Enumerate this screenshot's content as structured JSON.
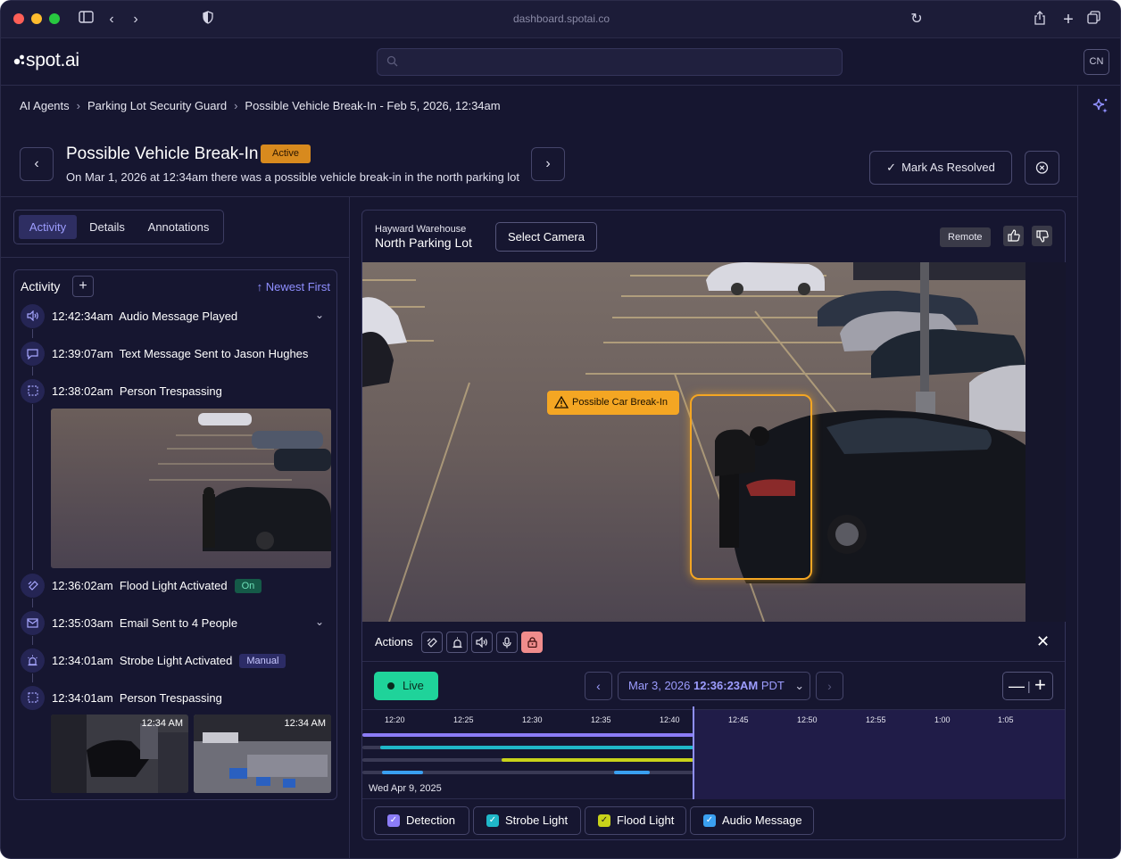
{
  "browser": {
    "url": "dashboard.spotai.co"
  },
  "app": {
    "logo": "spot.ai",
    "search_placeholder": "",
    "user_initials": "CN"
  },
  "breadcrumb": {
    "items": [
      "AI Agents",
      "Parking Lot Security Guard",
      "Possible Vehicle Break-In - Feb 5, 2026, 12:34am"
    ]
  },
  "incident": {
    "title": "Possible Vehicle Break-In",
    "status": "Active",
    "description": "On Mar 1, 2026 at 12:34am there was a possible vehicle break-in in the north parking lot",
    "resolve_label": "Mark As Resolved"
  },
  "tabs": [
    "Activity",
    "Details",
    "Annotations"
  ],
  "activity": {
    "title": "Activity",
    "sort_label": "Newest First",
    "items": [
      {
        "time": "12:42:34am",
        "text": "Audio Message Played",
        "icon": "speaker-icon"
      },
      {
        "time": "12:39:07am",
        "text": "Text Message Sent to Jason Hughes",
        "icon": "message-icon"
      },
      {
        "time": "12:38:02am",
        "text": "Person Trespassing",
        "icon": "person-detection-icon"
      },
      {
        "time": "12:36:02am",
        "text": "Flood Light Activated",
        "icon": "flood-light-icon",
        "badge": "On"
      },
      {
        "time": "12:35:03am",
        "text": "Email Sent to 4 People",
        "icon": "email-icon"
      },
      {
        "time": "12:34:01am",
        "text": "Strobe Light Activated",
        "icon": "strobe-light-icon",
        "badge": "Manual"
      },
      {
        "time": "12:34:01am",
        "text": "Person Trespassing",
        "icon": "person-detection-icon"
      }
    ],
    "thumb_times": [
      "12:34 AM",
      "12:34 AM"
    ]
  },
  "camera": {
    "site": "Hayward Warehouse",
    "name": "North Parking Lot",
    "select_label": "Select Camera",
    "mode": "Remote",
    "alert_label": "Possible Car Break-In"
  },
  "actions": {
    "label": "Actions",
    "buttons": [
      "flood-light-icon",
      "strobe-light-icon",
      "speaker-icon",
      "microphone-icon",
      "lock-icon"
    ]
  },
  "timeline": {
    "live_label": "Live",
    "datetime_prefix": "Mar 3, 2026 ",
    "datetime_time": "12:36:23AM",
    "datetime_suffix": " PDT",
    "ticks": [
      "12:20",
      "12:25",
      "12:30",
      "12:35",
      "12:40",
      "12:45",
      "12:50",
      "12:55",
      "1:00",
      "1:05"
    ],
    "date_label": "Wed Apr 9, 2025"
  },
  "legend": [
    {
      "label": "Detection",
      "color": "#8b7cf6"
    },
    {
      "label": "Strobe Light",
      "color": "#1fb7c9"
    },
    {
      "label": "Flood Light",
      "color": "#c8d21a"
    },
    {
      "label": "Audio Message",
      "color": "#3aa0f0"
    }
  ]
}
